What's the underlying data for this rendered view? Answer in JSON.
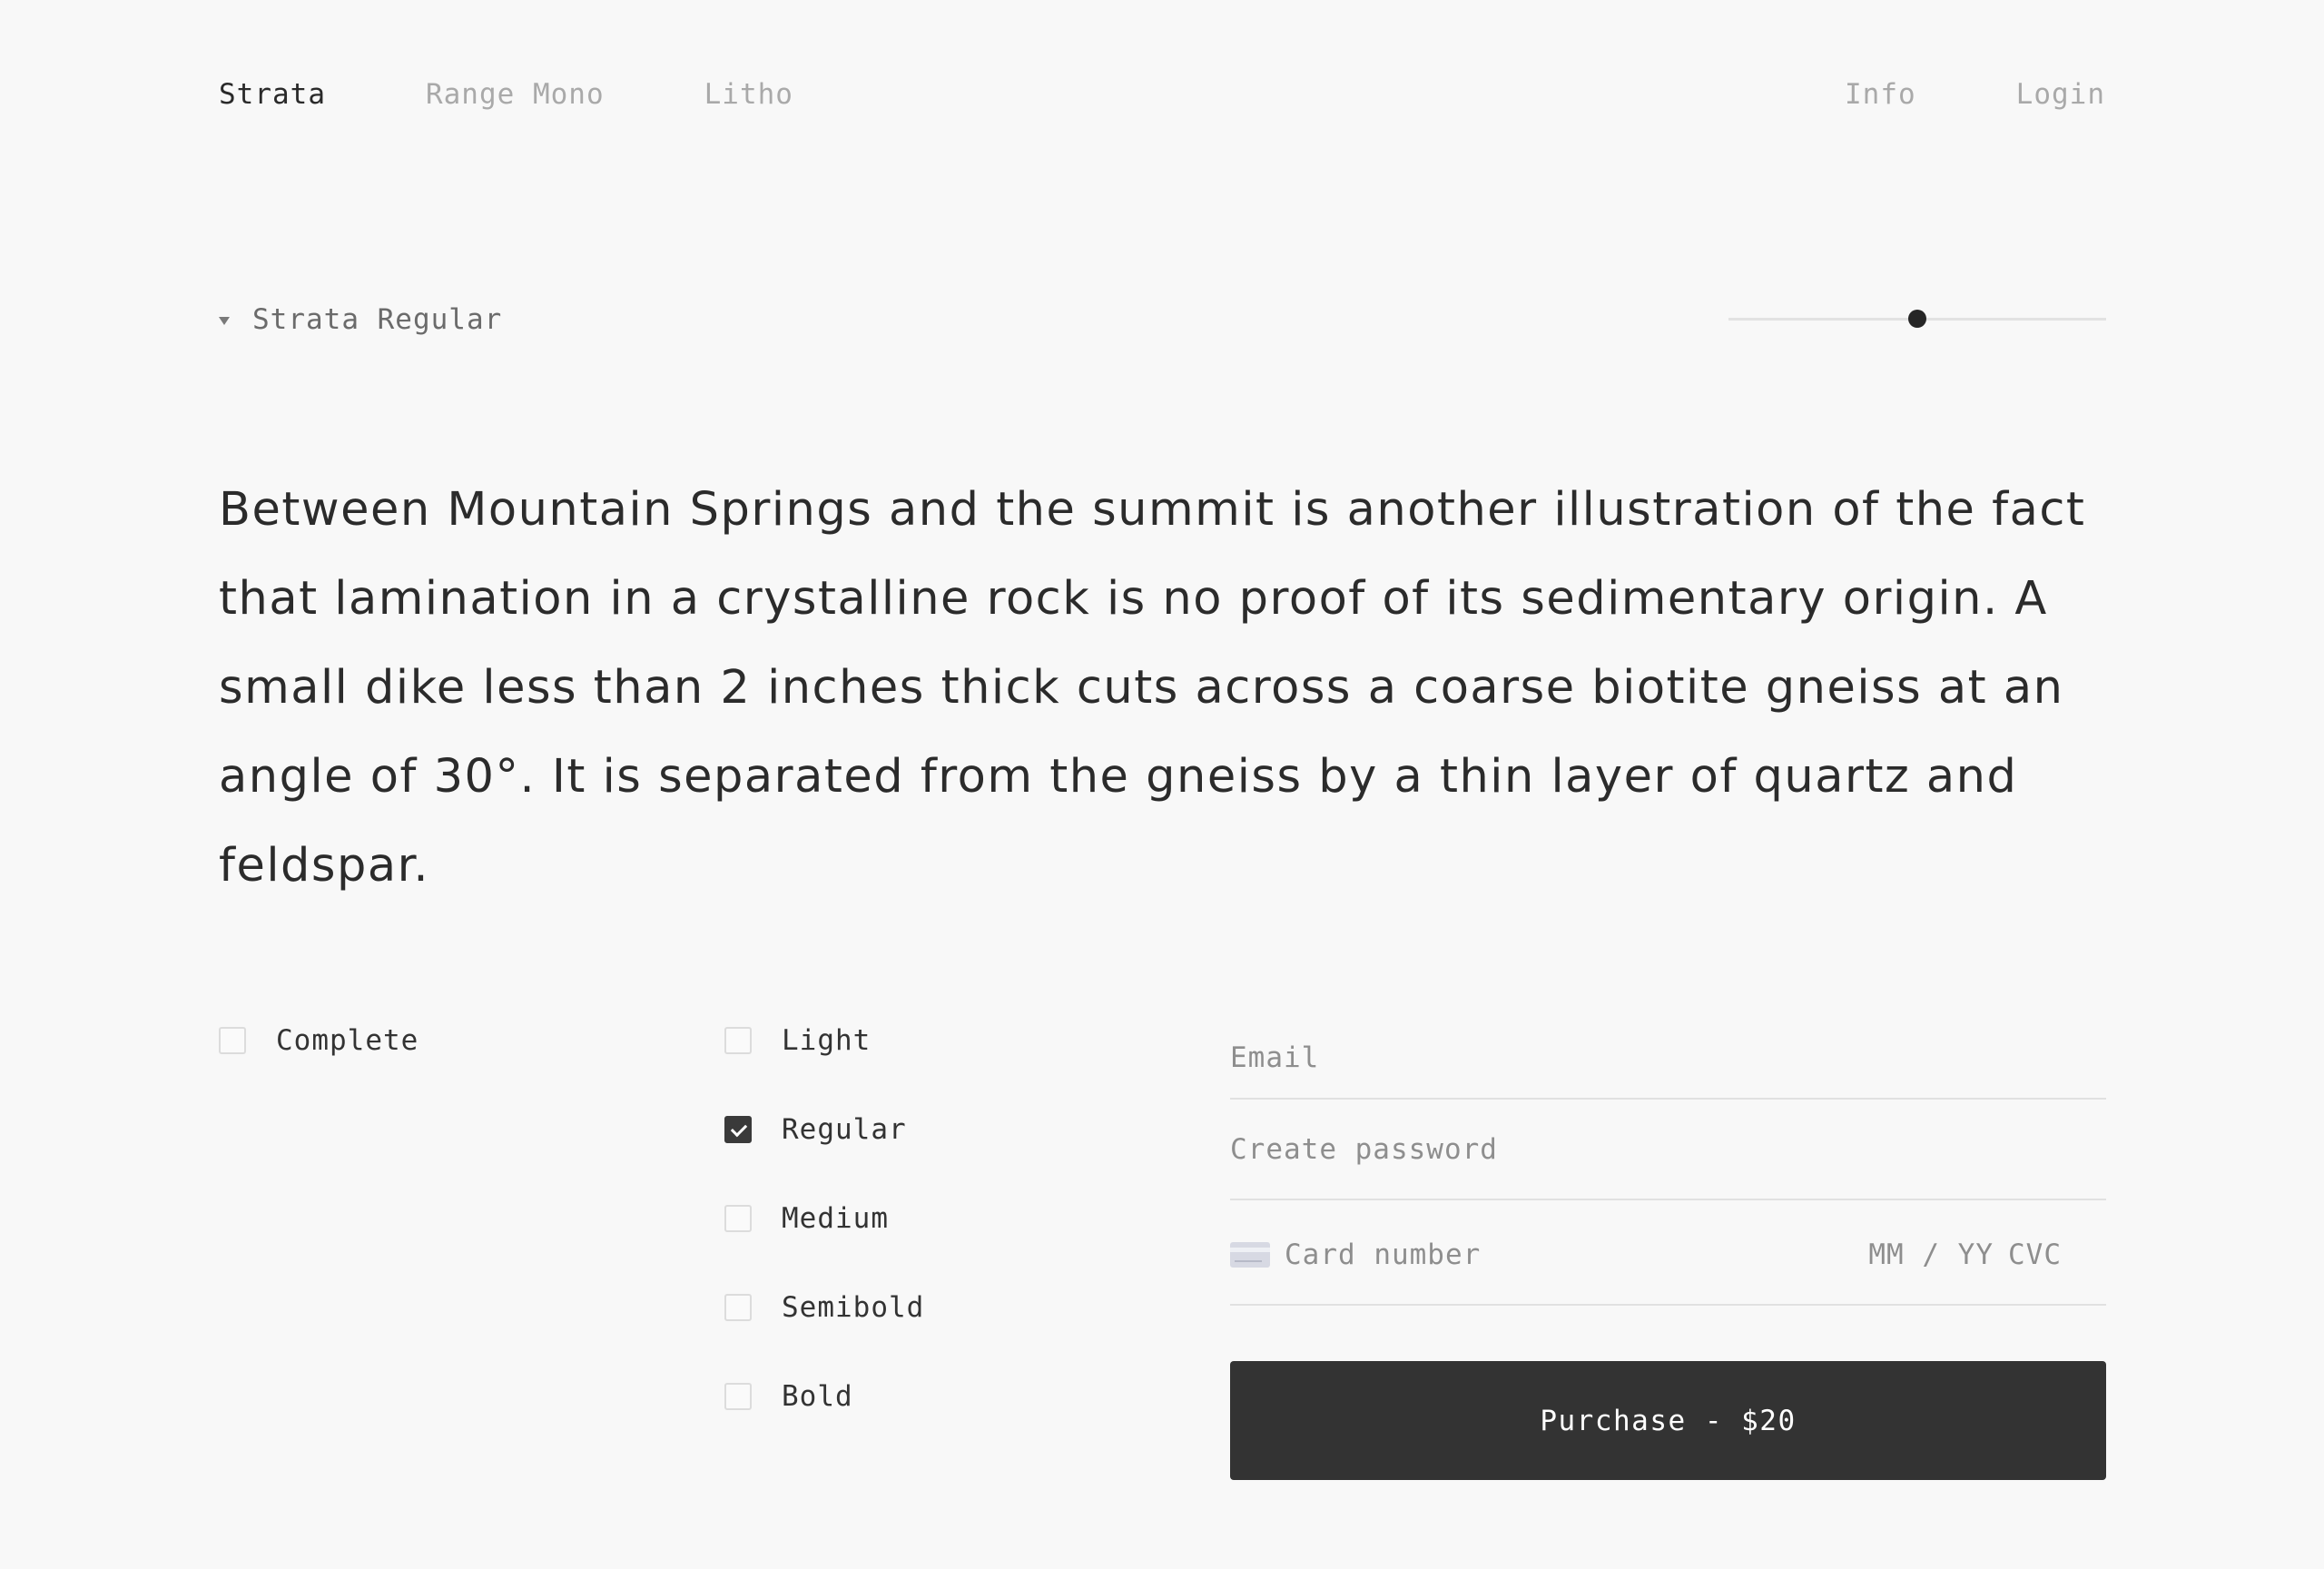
{
  "nav": {
    "left": [
      {
        "label": "Strata",
        "active": true
      },
      {
        "label": "Range Mono",
        "active": false
      },
      {
        "label": "Litho",
        "active": false
      }
    ],
    "right": [
      {
        "label": "Info"
      },
      {
        "label": "Login"
      }
    ]
  },
  "font_selector": {
    "label": "Strata Regular",
    "icon": "caret-down-icon"
  },
  "size_slider": {
    "value_fraction": 0.5
  },
  "sample_text": "Between Mountain Springs and the summit is another illustration of the fact that lamination in a crystalline rock is no proof of its sedimentary origin. A small dike less than 2 inches thick cuts across a coarse biotite gneiss at an angle of 30°. It is separated from the gneiss by a thin layer of quartz and feldspar.",
  "package_options": [
    {
      "label": "Complete",
      "checked": false
    }
  ],
  "weights": [
    {
      "label": "Light",
      "checked": false
    },
    {
      "label": "Regular",
      "checked": true
    },
    {
      "label": "Medium",
      "checked": false
    },
    {
      "label": "Semibold",
      "checked": false
    },
    {
      "label": "Bold",
      "checked": false
    }
  ],
  "form": {
    "email_placeholder": "Email",
    "password_placeholder": "Create password",
    "card_number_placeholder": "Card number",
    "expiry_placeholder": "MM / YY",
    "cvc_placeholder": "CVC",
    "card_icon": "credit-card-icon",
    "purchase_label": "Purchase - $20"
  },
  "colors": {
    "background": "#f8f8f8",
    "text": "#2b2b2b",
    "muted": "#a9a9a9",
    "button": "#333333",
    "button_text": "#ffffff"
  }
}
